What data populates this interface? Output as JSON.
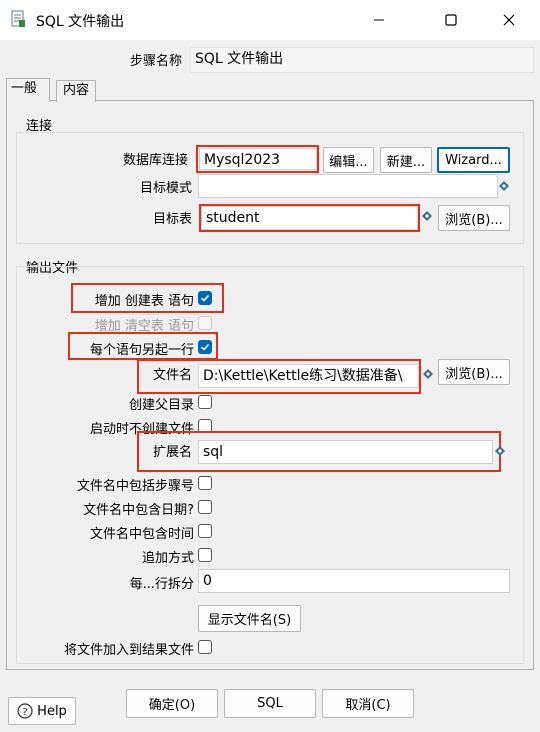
{
  "window": {
    "title": "SQL 文件输出",
    "minimize_icon": "minimize-icon",
    "maximize_icon": "maximize-icon",
    "close_icon": "close-icon"
  },
  "step_name": {
    "label": "步骤名称",
    "value": "SQL 文件输出"
  },
  "tabs": [
    {
      "label": "一般",
      "active": true
    },
    {
      "label": "内容",
      "active": false
    }
  ],
  "connection": {
    "group_label": "连接",
    "db_conn_label": "数据库连接",
    "db_conn_value": "Mysql2023",
    "edit_button": "编辑...",
    "new_button": "新建...",
    "wizard_button": "Wizard...",
    "schema_label": "目标模式",
    "schema_value": "",
    "table_label": "目标表",
    "table_value": "student",
    "browse_button": "浏览(B)..."
  },
  "output": {
    "group_label": "输出文件",
    "add_create_label": "增加 创建表 语句",
    "add_create_checked": true,
    "add_truncate_label": "增加 清空表 语句",
    "add_truncate_checked": false,
    "each_line_label": "每个语句另起一行",
    "each_line_checked": true,
    "filename_label": "文件名",
    "filename_value": "D:\\Kettle\\Kettle练习\\数据准备\\",
    "browse_button": "浏览(B)...",
    "create_parent_label": "创建父目录",
    "create_parent_checked": false,
    "no_create_label": "启动时不创建文件",
    "no_create_checked": false,
    "extension_label": "扩展名",
    "extension_value": "sql",
    "include_stepnr_label": "文件名中包括步骤号",
    "include_stepnr_checked": false,
    "include_date_label": "文件名中包含日期?",
    "include_date_checked": false,
    "include_time_label": "文件名中包含时间",
    "include_time_checked": false,
    "append_label": "追加方式",
    "append_checked": false,
    "split_label": "每...行拆分",
    "split_value": "0",
    "show_filenames_button": "显示文件名(S)",
    "add_to_result_label": "将文件加入到结果文件",
    "add_to_result_checked": false
  },
  "footer": {
    "help_button": "Help",
    "ok_button": "确定(O)",
    "sql_button": "SQL",
    "cancel_button": "取消(C)"
  },
  "colors": {
    "highlight_border": "#e0301e",
    "checkbox_checked": "#0067c0",
    "variable_icon": "#3a6f9a"
  }
}
